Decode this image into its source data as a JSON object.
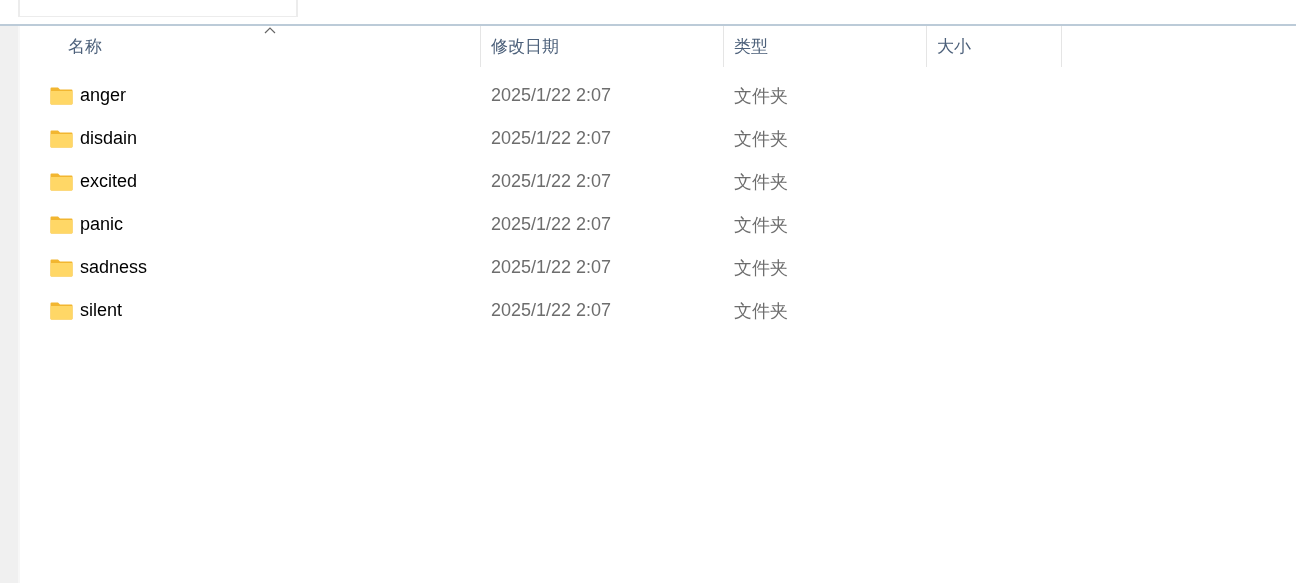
{
  "columns": [
    {
      "label": "名称",
      "sorted": true
    },
    {
      "label": "修改日期",
      "sorted": false
    },
    {
      "label": "类型",
      "sorted": false
    },
    {
      "label": "大小",
      "sorted": false
    }
  ],
  "rows": [
    {
      "name": "anger",
      "modified": "2025/1/22 2:07",
      "type": "文件夹"
    },
    {
      "name": "disdain",
      "modified": "2025/1/22 2:07",
      "type": "文件夹"
    },
    {
      "name": "excited",
      "modified": "2025/1/22 2:07",
      "type": "文件夹"
    },
    {
      "name": "panic",
      "modified": "2025/1/22 2:07",
      "type": "文件夹"
    },
    {
      "name": "sadness",
      "modified": "2025/1/22 2:07",
      "type": "文件夹"
    },
    {
      "name": "silent",
      "modified": "2025/1/22 2:07",
      "type": "文件夹"
    }
  ]
}
